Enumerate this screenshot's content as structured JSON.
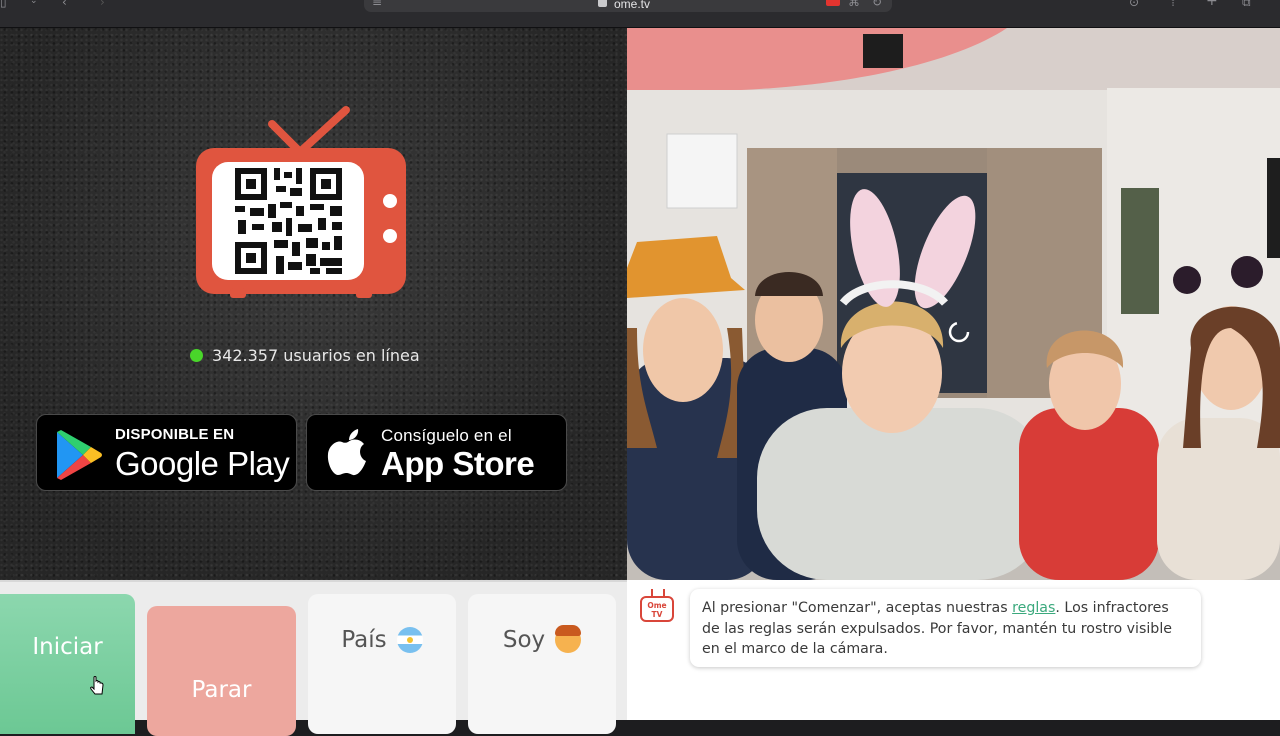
{
  "browser": {
    "url": "ome.tv"
  },
  "promo": {
    "online_count": "342.357 usuarios en línea",
    "google_play": {
      "small": "DISPONIBLE EN",
      "big": "Google Play"
    },
    "app_store": {
      "small": "Consíguelo en el",
      "big": "App Store"
    }
  },
  "controls": {
    "start_label": "Iniciar",
    "stop_label": "Parar",
    "country_label": "País",
    "gender_label": "Soy"
  },
  "chat": {
    "logo_line1": "Ome",
    "logo_line2": "TV",
    "notice_before": "Al presionar \"Comenzar\", aceptas nuestras ",
    "notice_link": "reglas",
    "notice_after": ". Los infractores de las reglas serán expulsados. Por favor, mantén tu rostro visible en el marco de la cámara."
  },
  "colors": {
    "start_green": "#6cc894",
    "stop_red": "#eda79e",
    "brand_red": "#d9463a",
    "online_green": "#49d62a",
    "link_green": "#3ba97d"
  }
}
